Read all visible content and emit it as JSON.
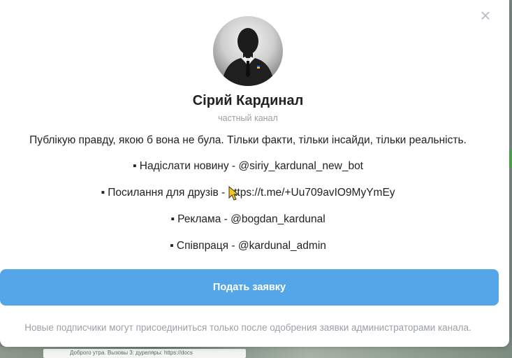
{
  "modal": {
    "close_symbol": "×",
    "channel_name": "Сірий Кардинал",
    "channel_type": "частный канал",
    "description": "Публікую правду, якою б вона не була. Тільки факти, тільки інсайди, тільки реальність.",
    "links": [
      {
        "label": "Надіслати новину - ",
        "value": "@siriy_kardunal_new_bot"
      },
      {
        "label": "Посилання для друзів - ",
        "value": "https://t.me/+Uu709avIO9MyYmEy"
      },
      {
        "label": "Реклама - ",
        "value": "@bogdan_kardunal"
      },
      {
        "label": "Співпраця - ",
        "value": "@kardunal_admin"
      }
    ],
    "bullet_char": "▪",
    "request_button_label": "Подать заявку",
    "note": "Новые подписчики могут присоединиться только после одобрения заявки администраторами канала."
  },
  "background": {
    "preview_text": "Доброго утра. Вызовы 3: дуреляры: https://docs"
  },
  "colors": {
    "accent": "#55a6e9",
    "muted_text": "#9aa0a6",
    "primary_text": "#222222"
  },
  "icons": {
    "close": "close-icon",
    "cursor": "mouse-pointer-icon",
    "avatar": "channel-avatar"
  }
}
